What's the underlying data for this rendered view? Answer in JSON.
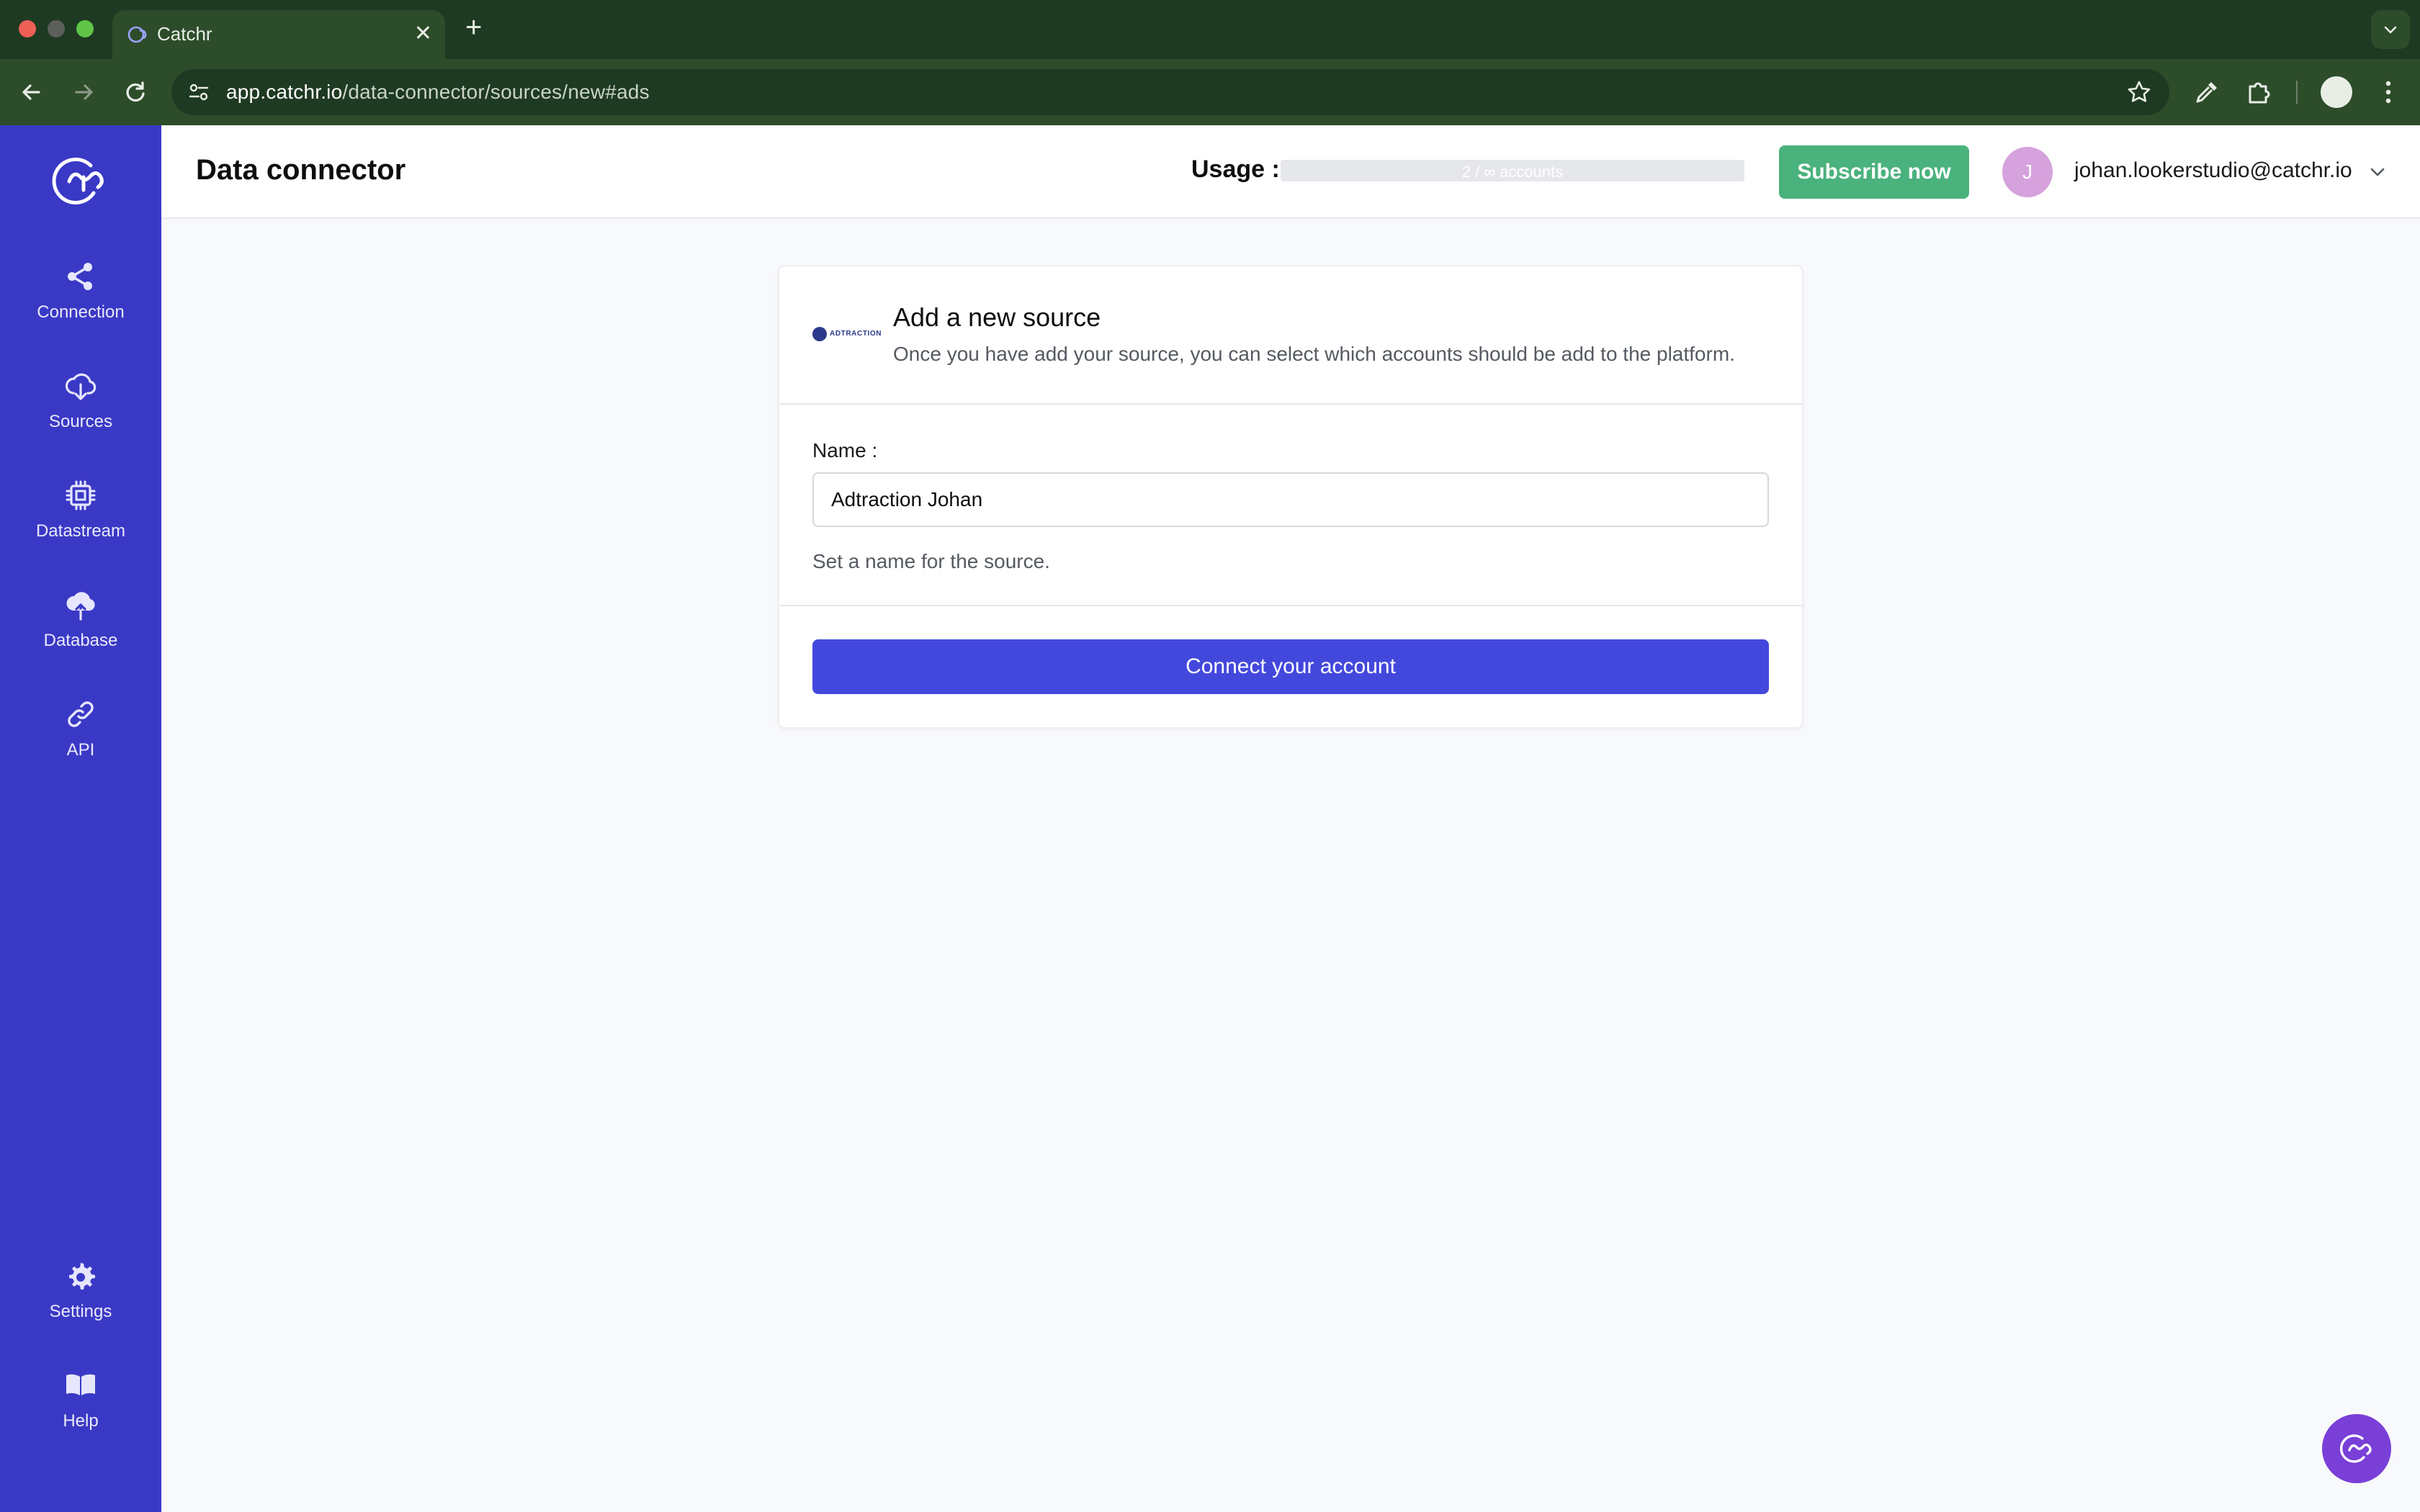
{
  "browser": {
    "tab_title": "Catchr",
    "tab_close": "✕",
    "new_tab": "+",
    "url_host": "app.catchr.io",
    "url_path": "/data-connector/sources/new#ads"
  },
  "sidebar": {
    "items": [
      {
        "label": "Connection",
        "icon": "share-icon"
      },
      {
        "label": "Sources",
        "icon": "cloud-download-icon"
      },
      {
        "label": "Datastream",
        "icon": "cpu-chip-icon"
      },
      {
        "label": "Database",
        "icon": "cloud-upload-icon"
      },
      {
        "label": "API",
        "icon": "link-icon"
      }
    ],
    "bottom_items": [
      {
        "label": "Settings",
        "icon": "gear-icon"
      },
      {
        "label": "Help",
        "icon": "book-icon"
      }
    ]
  },
  "header": {
    "title": "Data connector",
    "usage_label": "Usage :",
    "usage_text": "2 / ∞ accounts",
    "subscribe_label": "Subscribe now",
    "avatar_initial": "J",
    "user_email": "johan.lookerstudio@catchr.io"
  },
  "card": {
    "source_logo_text": "ADTRACTION",
    "title": "Add a new source",
    "subtitle": "Once you have add your source, you can select which accounts should be add to the platform.",
    "name_label": "Name :",
    "name_value": "Adtraction Johan",
    "name_help": "Set a name for the source.",
    "connect_label": "Connect your account"
  },
  "colors": {
    "sidebar": "#3a39c6",
    "primary_button": "#4348dc",
    "subscribe_button": "#4ab27c",
    "browser_chrome": "#2d4c2a",
    "avatar": "#d6a2dd",
    "chat_bubble": "#7a3fd7"
  }
}
